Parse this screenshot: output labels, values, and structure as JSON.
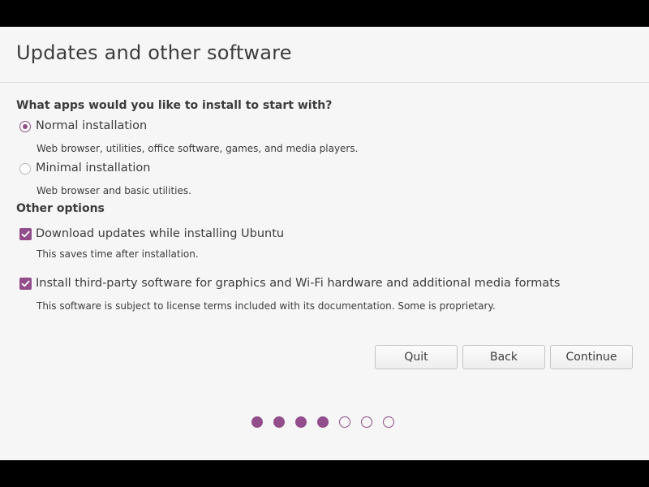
{
  "window": {
    "title": "Updates and other software"
  },
  "install_type": {
    "heading": "What apps would you like to install to start with?",
    "options": [
      {
        "label": "Normal installation",
        "description": "Web browser, utilities, office software, games, and media players.",
        "selected": true
      },
      {
        "label": "Minimal installation",
        "description": "Web browser and basic utilities.",
        "selected": false
      }
    ]
  },
  "other_options": {
    "heading": "Other options",
    "items": [
      {
        "label": "Download updates while installing Ubuntu",
        "description": "This saves time after installation.",
        "checked": true
      },
      {
        "label": "Install third-party software for graphics and Wi-Fi hardware and additional media formats",
        "description": "This software is subject to license terms included with its documentation. Some is proprietary.",
        "checked": true
      }
    ]
  },
  "buttons": {
    "quit": "Quit",
    "back": "Back",
    "continue": "Continue"
  },
  "progress": {
    "total_steps": 7,
    "completed_steps": 4
  },
  "colors": {
    "accent": "#924d8b",
    "background": "#f6f6f6",
    "text": "#3c3c3c"
  },
  "icons": {
    "checkbox_mark": "checkmark-icon",
    "radio_selected": "radio-selected-icon",
    "radio_unselected": "radio-unselected-icon"
  }
}
